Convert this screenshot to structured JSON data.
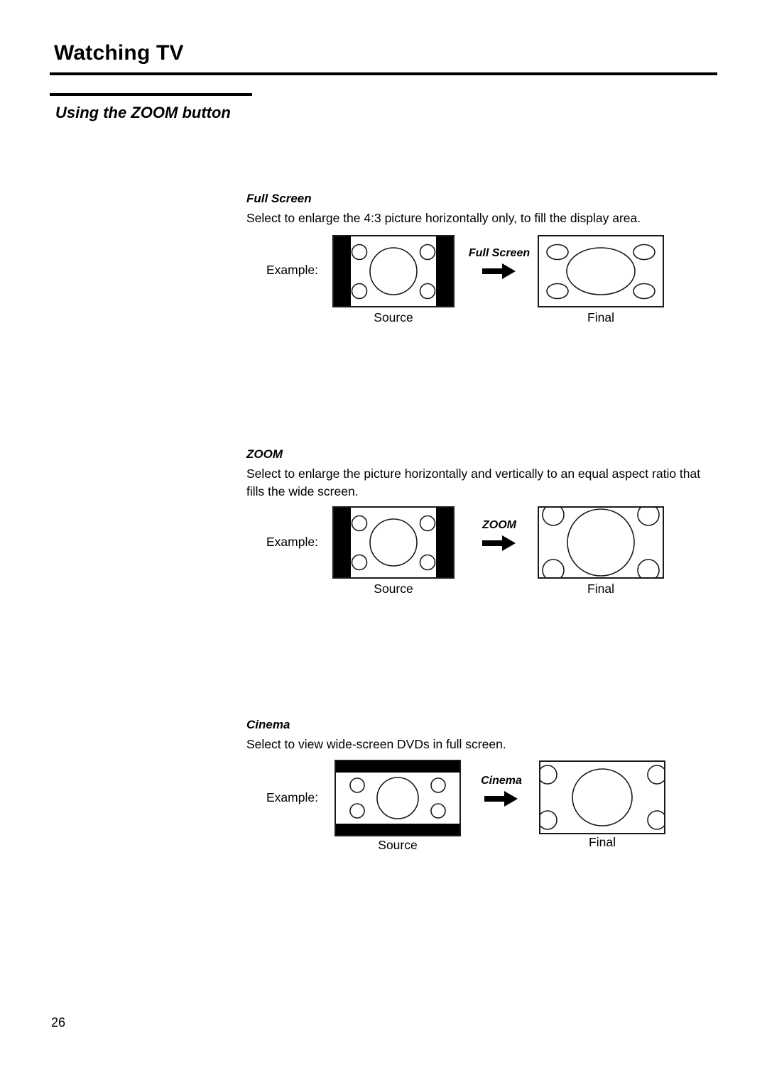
{
  "header": {
    "title": "Watching TV",
    "section": "Using the ZOOM button"
  },
  "modes": [
    {
      "name": "Full Screen",
      "description": "Select to enlarge the 4:3 picture horizontally only, to fill the display area.",
      "example_label": "Example:",
      "arrow_label": "Full Screen",
      "arrow_icon": "right-arrow-icon",
      "source_caption": "Source",
      "final_caption": "Final",
      "source_bars": "pillarbox",
      "final_shape": "horizontally-stretched-ellipses"
    },
    {
      "name": "ZOOM",
      "description": "Select to enlarge the picture horizontally and vertically to an equal aspect ratio that fills the wide screen.",
      "example_label": "Example:",
      "arrow_label": "ZOOM",
      "arrow_icon": "right-arrow-icon",
      "source_caption": "Source",
      "final_caption": "Final",
      "source_bars": "pillarbox",
      "final_shape": "uniformly-enlarged-clipped-circles"
    },
    {
      "name": "Cinema",
      "description": "Select to view wide-screen DVDs in full screen.",
      "example_label": "Example:",
      "arrow_label": "Cinema",
      "arrow_icon": "right-arrow-icon",
      "source_caption": "Source",
      "final_caption": "Final",
      "source_bars": "letterbox",
      "final_shape": "vertically-enlarged-clipped-circles"
    }
  ],
  "footer": {
    "page_number": "26"
  },
  "colors": {
    "ink": "#000000",
    "paper": "#ffffff",
    "outline": "#1a1a1a"
  }
}
